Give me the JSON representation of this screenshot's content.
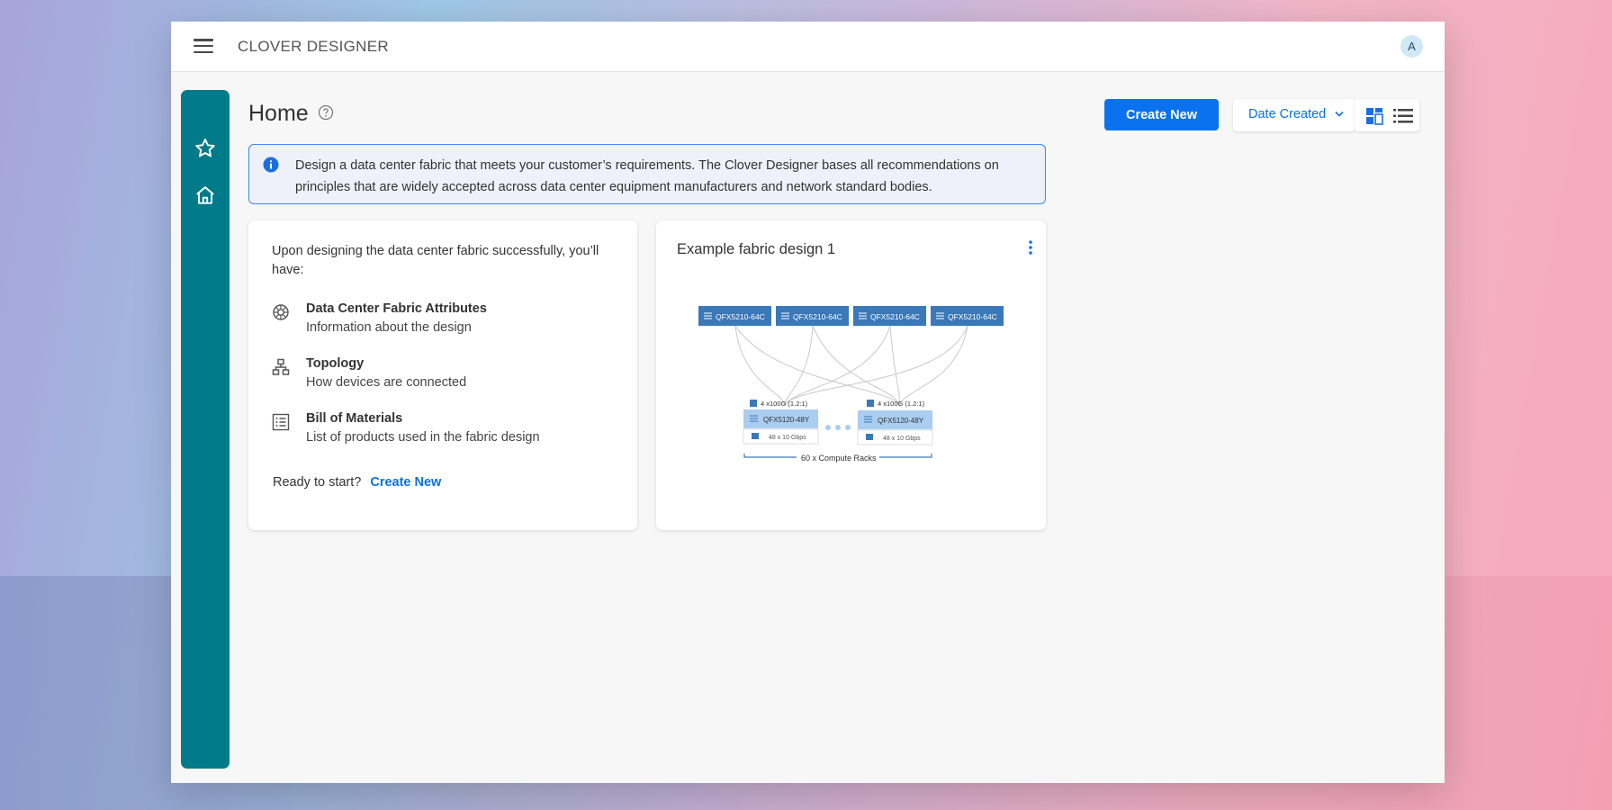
{
  "app": {
    "title": "CLOVER DESIGNER",
    "avatar_initial": "A"
  },
  "page": {
    "title": "Home"
  },
  "info": {
    "text": "Design a data center fabric that meets your customer’s requirements. The Clover Designer bases all recommendations on principles that are widely accepted across data center equipment manufacturers and network standard bodies."
  },
  "toolbar": {
    "create_label": "Create New",
    "sort_label": "Date Created"
  },
  "intro_card": {
    "intro": "Upon designing the data center fabric successfully, you’ll have:",
    "features": [
      {
        "icon": "fabric-attributes-icon",
        "title": "Data Center Fabric Attributes",
        "subtitle": "Information about the design"
      },
      {
        "icon": "topology-icon",
        "title": "Topology",
        "subtitle": "How devices are connected"
      },
      {
        "icon": "bill-of-materials-icon",
        "title": "Bill of Materials",
        "subtitle": "List of products used in the fabric design"
      }
    ],
    "ready_text": "Ready to start?",
    "ready_link": "Create New"
  },
  "example_card": {
    "title": "Example fabric design 1",
    "spines": [
      "QFX5210-64C",
      "QFX5210-64C",
      "QFX5210-64C",
      "QFX5210-64C"
    ],
    "leaves": [
      {
        "uplink": "4 x100G (1.2:1)",
        "model": "QFX5120-48Y",
        "ports": "48 x 10 Gbps"
      },
      {
        "uplink": "4 x100G (1.2:1)",
        "model": "QFX5120-48Y",
        "ports": "48 x 10 Gbps"
      }
    ],
    "racks_label": "60 x Compute Racks"
  },
  "colors": {
    "accent": "#0a72ef",
    "sidebar": "#017a8a",
    "spine": "#3a78b8",
    "leaf": "#aacdf0"
  }
}
